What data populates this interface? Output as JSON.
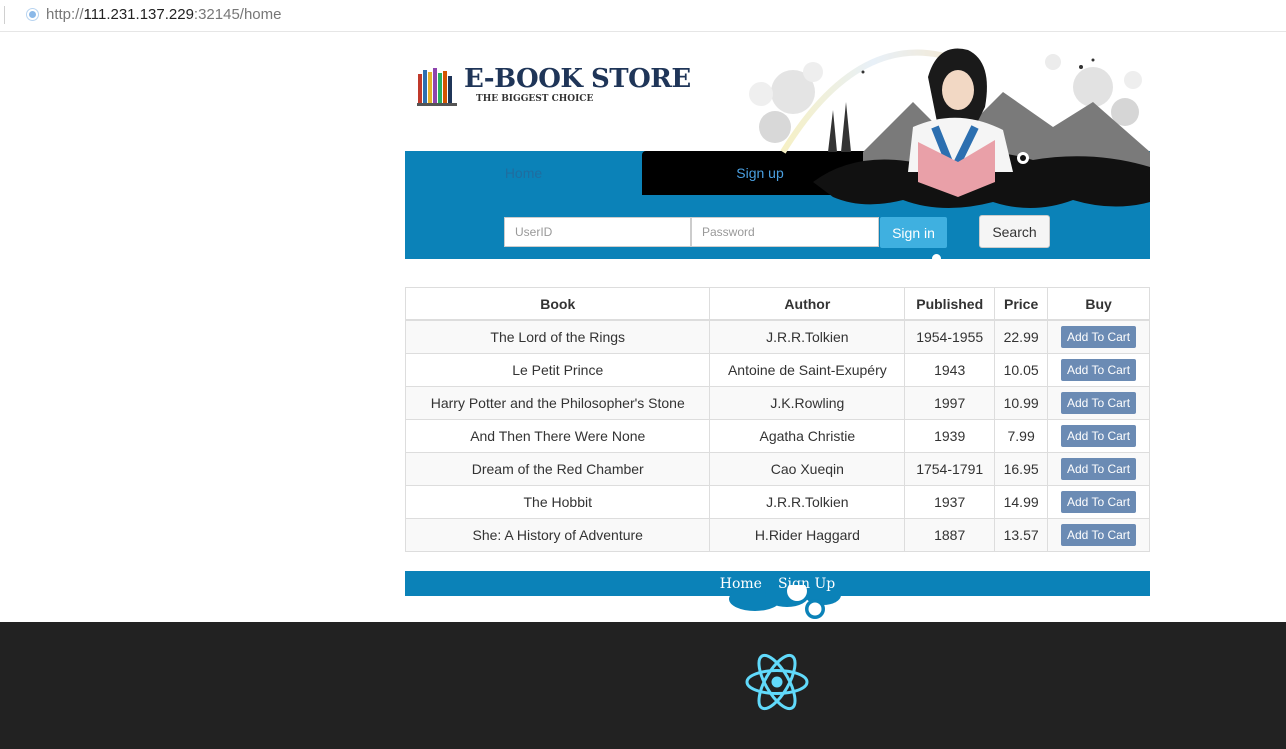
{
  "browser": {
    "url_scheme": "http://",
    "url_host": "111.231.137.229",
    "url_rest": ":32145/home"
  },
  "logo": {
    "title": "E-BOOK STORE",
    "subtitle": "THE BIGGEST CHOICE"
  },
  "nav": {
    "home": "Home",
    "signup": "Sign up"
  },
  "login": {
    "user_placeholder": "UserID",
    "pass_placeholder": "Password",
    "signin_label": "Sign in",
    "search_label": "Search"
  },
  "table": {
    "headers": [
      "Book",
      "Author",
      "Published",
      "Price",
      "Buy"
    ],
    "rows": [
      {
        "book": "The Lord of the Rings",
        "author": "J.R.R.Tolkien",
        "published": "1954-1955",
        "price": "22.99",
        "buy": "Add To Cart"
      },
      {
        "book": "Le Petit Prince",
        "author": "Antoine de Saint-Exupéry",
        "published": "1943",
        "price": "10.05",
        "buy": "Add To Cart"
      },
      {
        "book": "Harry Potter and the Philosopher's Stone",
        "author": "J.K.Rowling",
        "published": "1997",
        "price": "10.99",
        "buy": "Add To Cart"
      },
      {
        "book": "And Then There Were None",
        "author": "Agatha Christie",
        "published": "1939",
        "price": "7.99",
        "buy": "Add To Cart"
      },
      {
        "book": "Dream of the Red Chamber",
        "author": "Cao Xueqin",
        "published": "1754-1791",
        "price": "16.95",
        "buy": "Add To Cart"
      },
      {
        "book": "The Hobbit",
        "author": "J.R.R.Tolkien",
        "published": "1937",
        "price": "14.99",
        "buy": "Add To Cart"
      },
      {
        "book": "She: A History of Adventure",
        "author": "H.Rider Haggard",
        "published": "1887",
        "price": "13.57",
        "buy": "Add To Cart"
      }
    ]
  },
  "footer": {
    "home": "Home",
    "signup": "Sign Up"
  },
  "colors": {
    "accent_blue": "#0b82b8",
    "button_blue": "#3fb0e0",
    "cart_button": "#6b8bb4",
    "dev_bar": "#222222",
    "react_logo": "#61dafb"
  },
  "icons": {
    "address_bar": "globe-icon",
    "dev_bar": "react-logo-icon"
  }
}
